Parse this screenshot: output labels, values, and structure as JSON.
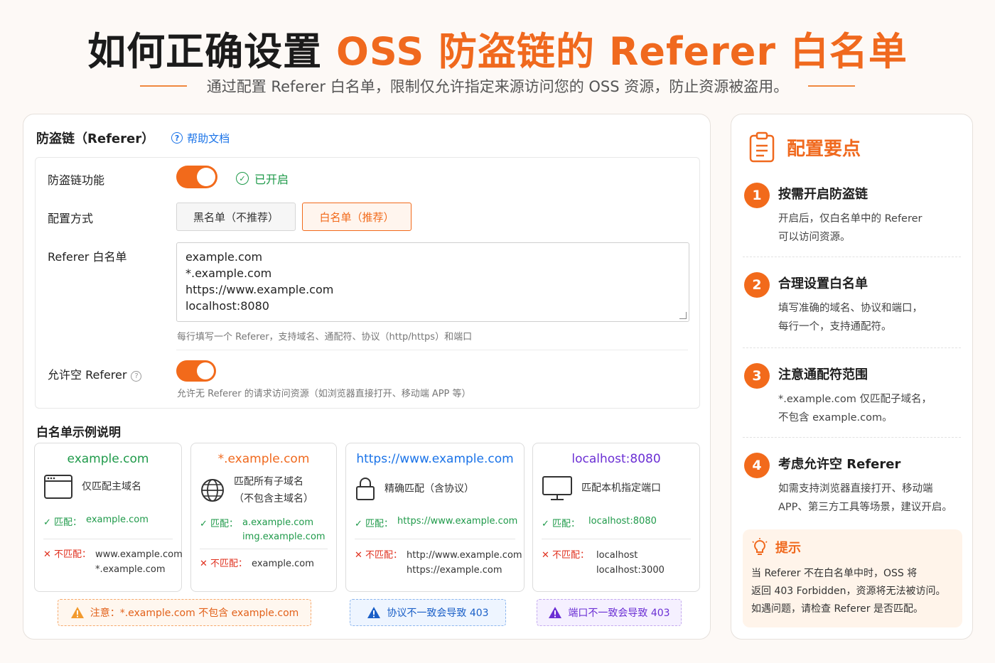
{
  "hero": {
    "title_dark": "如何正确设置 ",
    "title_accent": "OSS 防盗链的 Referer 白名单",
    "subtitle": "通过配置 Referer 白名单，限制仅允许指定来源访问您的 OSS 资源，防止资源被盗用。"
  },
  "panel": {
    "title": "防盗链（Referer）",
    "help_link": "帮助文档",
    "help_icon": "?",
    "rows": {
      "hotlink_label": "防盗链功能",
      "hotlink_status": "已开启",
      "hotlink_enabled": true,
      "mode_label": "配置方式",
      "mode_blacklist": "黑名单（不推荐）",
      "mode_whitelist": "白名单（推荐）",
      "whitelist_label": "Referer 白名单",
      "whitelist_entries": [
        "example.com",
        "*.example.com",
        "https://www.example.com",
        "localhost:8080"
      ],
      "whitelist_hint": "每行填写一个 Referer，支持域名、通配符、协议（http/https）和端口",
      "allow_empty_label": "允许空 Referer",
      "allow_empty_enabled": true,
      "allow_empty_hint": "允许无 Referer 的请求访问资源（如浏览器直接打开、移动端 APP 等）"
    }
  },
  "examples": {
    "title": "白名单示例说明",
    "match_label": "匹配：",
    "nomatch_label": "不匹配：",
    "cards": [
      {
        "domain": "example.com",
        "color": "#1f9a4a",
        "icon": "browser-window-icon",
        "desc": [
          "仅匹配主域名"
        ],
        "match": [
          "example.com"
        ],
        "nomatch": [
          "www.example.com",
          "*.example.com"
        ]
      },
      {
        "domain": "*.example.com",
        "color": "#f0691e",
        "icon": "globe-icon",
        "desc": [
          "匹配所有子域名",
          "（不包含主域名）"
        ],
        "match": [
          "a.example.com",
          "img.example.com"
        ],
        "nomatch": [
          "example.com"
        ]
      },
      {
        "domain": "https://www.example.com",
        "color": "#1a73e8",
        "icon": "lock-icon",
        "desc": [
          "精确匹配（含协议）"
        ],
        "match": [
          "https://www.example.com"
        ],
        "nomatch": [
          "http://www.example.com",
          "https://example.com"
        ]
      },
      {
        "domain": "localhost:8080",
        "color": "#6b2fd4",
        "icon": "monitor-icon",
        "desc": [
          "匹配本机指定端口"
        ],
        "match": [
          "localhost:8080"
        ],
        "nomatch": [
          "localhost",
          "localhost:3000"
        ]
      }
    ],
    "notes": {
      "orange": "注意：*.example.com 不包含 example.com",
      "blue": "协议不一致会导致 403",
      "purple": "端口不一致会导致 403"
    }
  },
  "side": {
    "title": "配置要点",
    "tips": [
      {
        "num": "1",
        "title": "按需开启防盗链",
        "body": [
          "开启后，仅白名单中的 Referer",
          "可以访问资源。"
        ]
      },
      {
        "num": "2",
        "title": "合理设置白名单",
        "body": [
          "填写准确的域名、协议和端口，",
          "每行一个，支持通配符。"
        ]
      },
      {
        "num": "3",
        "title": "注意通配符范围",
        "body": [
          "*.example.com 仅匹配子域名，",
          "不包含 example.com。"
        ]
      },
      {
        "num": "4",
        "title": "考虑允许空 Referer",
        "body": [
          "如需支持浏览器直接打开、移动端",
          "APP、第三方工具等场景，建议开启。"
        ]
      }
    ],
    "hint": {
      "title": "提示",
      "body": [
        "当 Referer 不在白名单中时，OSS 将",
        "返回 403 Forbidden，资源将无法被访问。",
        "如遇问题，请检查 Referer 是否匹配。"
      ]
    }
  },
  "colors": {
    "accent": "#f0691e",
    "success": "#1f9a4a",
    "error": "#e0301e",
    "link": "#1a73e8"
  }
}
